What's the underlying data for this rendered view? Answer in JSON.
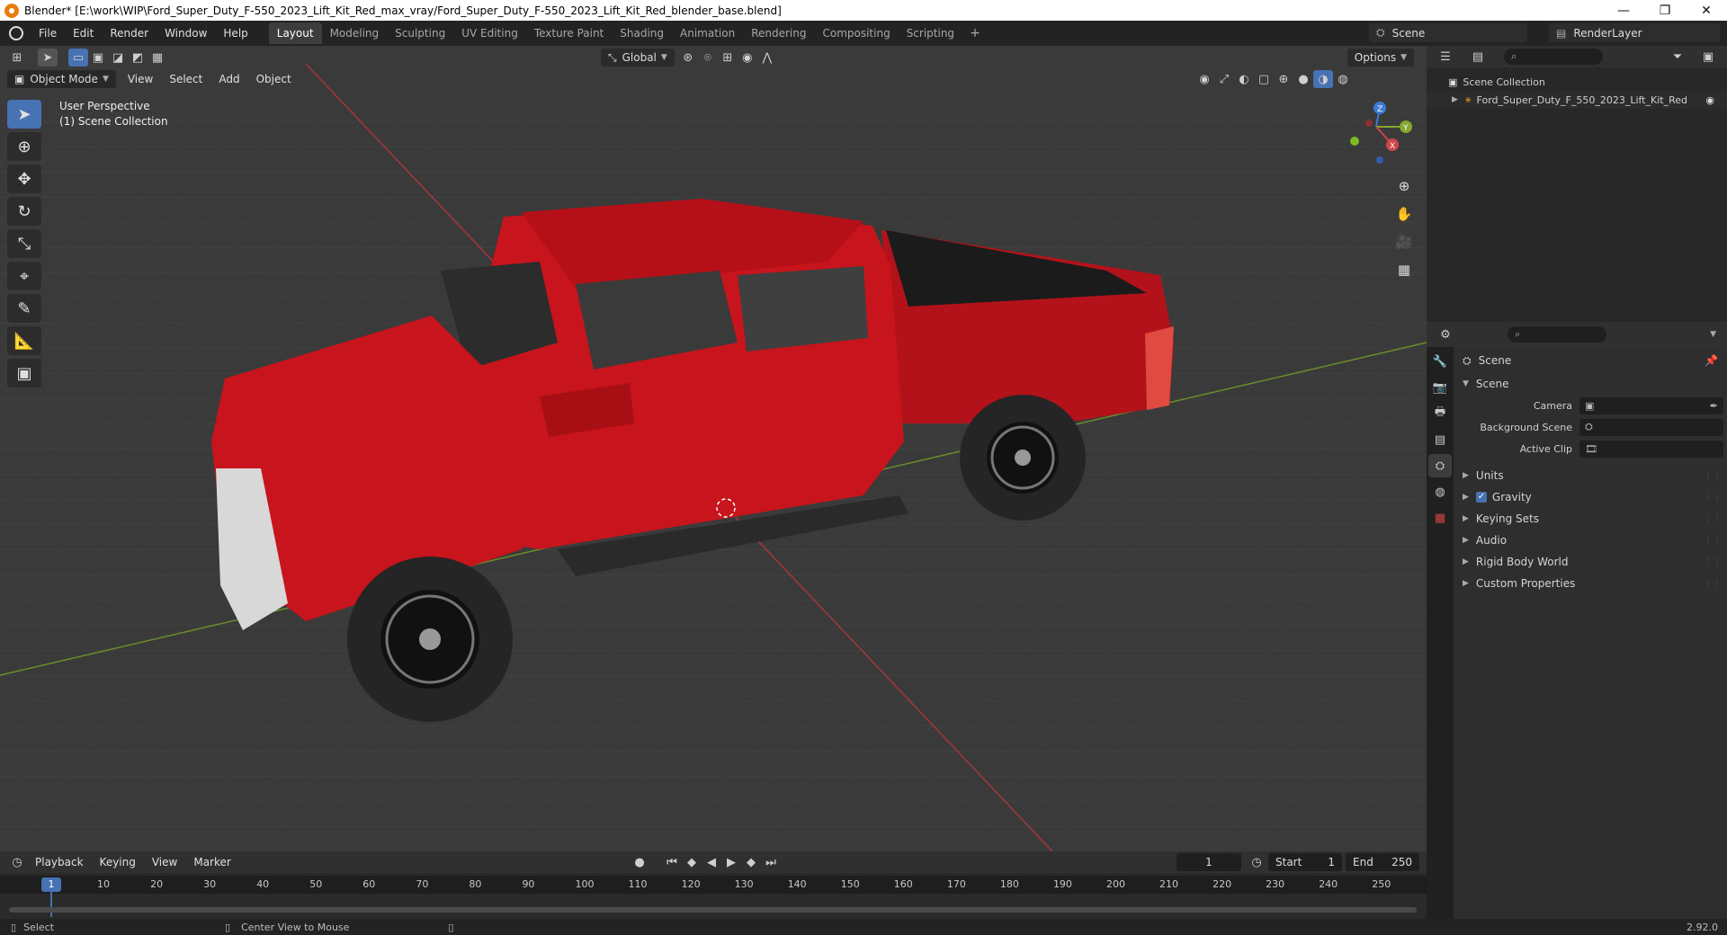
{
  "window": {
    "title": "Blender* [E:\\work\\WIP\\Ford_Super_Duty_F-550_2023_Lift_Kit_Red_max_vray/Ford_Super_Duty_F-550_2023_Lift_Kit_Red_blender_base.blend]",
    "minimize": "—",
    "restore": "❐",
    "close": "✕"
  },
  "menu": {
    "file": "File",
    "edit": "Edit",
    "render": "Render",
    "window": "Window",
    "help": "Help"
  },
  "workspaces": [
    "Layout",
    "Modeling",
    "Sculpting",
    "UV Editing",
    "Texture Paint",
    "Shading",
    "Animation",
    "Rendering",
    "Compositing",
    "Scripting"
  ],
  "active_workspace": "Layout",
  "scene_name": "Scene",
  "render_layer": "RenderLayer",
  "viewport": {
    "mode": "Object Mode",
    "menus": {
      "view": "View",
      "select": "Select",
      "add": "Add",
      "object": "Object"
    },
    "orientation": "Global",
    "options": "Options",
    "overlay_line1": "User Perspective",
    "overlay_line2": "(1) Scene Collection",
    "gizmo": {
      "x": "X",
      "y": "Y",
      "z": "Z"
    }
  },
  "timeline": {
    "menus": {
      "playback": "Playback",
      "keying": "Keying",
      "view": "View",
      "marker": "Marker"
    },
    "current_frame": "1",
    "start_label": "Start",
    "start": "1",
    "end_label": "End",
    "end": "250",
    "ticks": [
      "10",
      "20",
      "30",
      "40",
      "50",
      "60",
      "70",
      "80",
      "90",
      "100",
      "110",
      "120",
      "130",
      "140",
      "150",
      "160",
      "170",
      "180",
      "190",
      "200",
      "210",
      "220",
      "230",
      "240",
      "250"
    ]
  },
  "outliner": {
    "root": "Scene Collection",
    "item": "Ford_Super_Duty_F_550_2023_Lift_Kit_Red"
  },
  "properties": {
    "header": "Scene",
    "panel": "Scene",
    "camera_label": "Camera",
    "background_label": "Background Scene",
    "clip_label": "Active Clip",
    "sections": {
      "units": "Units",
      "gravity": "Gravity",
      "keying_sets": "Keying Sets",
      "audio": "Audio",
      "rigid_body": "Rigid Body World",
      "custom": "Custom Properties"
    }
  },
  "status": {
    "select": "Select",
    "center": "Center View to Mouse",
    "version": "2.92.0"
  },
  "colors": {
    "accent": "#4772b3",
    "truck": "#c8141c",
    "x_axis": "#c0343c",
    "y_axis": "#6a9a23"
  }
}
